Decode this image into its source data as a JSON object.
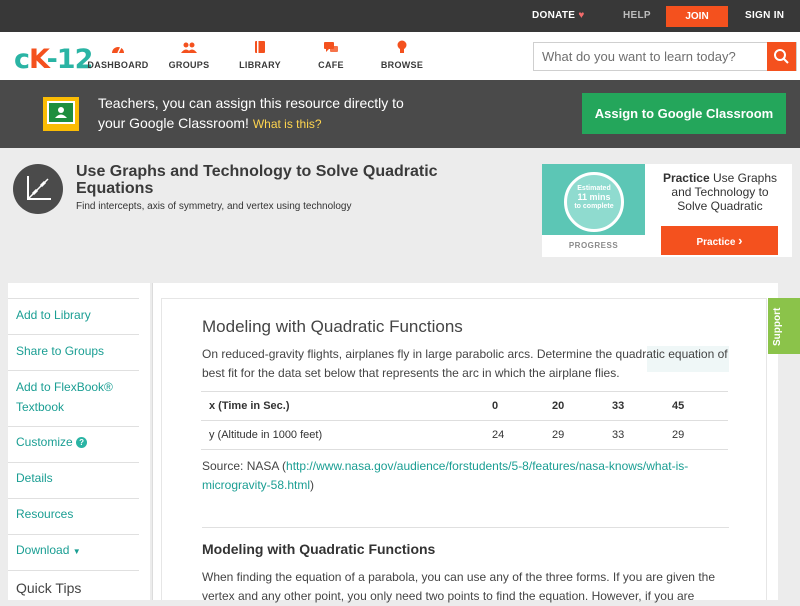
{
  "topbar": {
    "donate": "DONATE",
    "help": "HELP",
    "join": "JOIN",
    "signin": "SIGN IN"
  },
  "logo": {
    "c": "c",
    "k": "K",
    "n": "-12"
  },
  "nav": [
    {
      "label": "DASHBOARD",
      "icon": "gauge-icon"
    },
    {
      "label": "GROUPS",
      "icon": "people-icon"
    },
    {
      "label": "LIBRARY",
      "icon": "book-icon"
    },
    {
      "label": "CAFE",
      "icon": "chat-icon"
    },
    {
      "label": "BROWSE",
      "icon": "lightbulb-icon"
    }
  ],
  "search": {
    "placeholder": "What do you want to learn today?"
  },
  "banner": {
    "line1": "Teachers, you can assign this resource directly to",
    "line2": "your Google Classroom!",
    "what": "What is this?",
    "assign": "Assign to Google Classroom"
  },
  "header": {
    "title": "Use Graphs and Technology to Solve Quadratic Equations",
    "subtitle": "Find intercepts, axis of symmetry, and vertex using technology"
  },
  "practice": {
    "ring_line1": "Estimated",
    "ring_line2": "11 mins",
    "ring_line3": "to complete",
    "progress": "PROGRESS",
    "bold": "Practice",
    "text": "Use Graphs and Technology to Solve Quadratic",
    "button": "Practice"
  },
  "sidebar": {
    "items": [
      "Add to Library",
      "Share to Groups",
      "Add to FlexBook®",
      "Textbook",
      "Customize",
      "Details",
      "Resources",
      "Download"
    ],
    "quick_tips": "Quick Tips"
  },
  "content": {
    "heading": "Modeling with Quadratic Functions",
    "para1": "On reduced-gravity flights, airplanes fly in large parabolic arcs. Determine the quadratic equation of best fit for the data set below that represents the arc in which the airplane flies.",
    "table": {
      "row1_label": "x (Time in Sec.)",
      "row1": [
        "0",
        "20",
        "33",
        "45"
      ],
      "row2_label": "y (Altitude in 1000 feet)",
      "row2": [
        "24",
        "29",
        "33",
        "29"
      ]
    },
    "source_prefix": "Source: NASA (",
    "source_link": "http://www.nasa.gov/audience/forstudents/5-8/features/nasa-knows/what-is-microgravity-58.html",
    "source_suffix": ")",
    "section_heading": "Modeling with Quadratic Functions",
    "para2": "When finding the equation of a parabola, you can use any of the three forms. If you are given the vertex and any other point, you only need two points to find the equation. However, if you are"
  },
  "support": "Support",
  "colors": {
    "accent": "#f4511e",
    "teal": "#2ab4a4",
    "green": "#24a65b"
  }
}
